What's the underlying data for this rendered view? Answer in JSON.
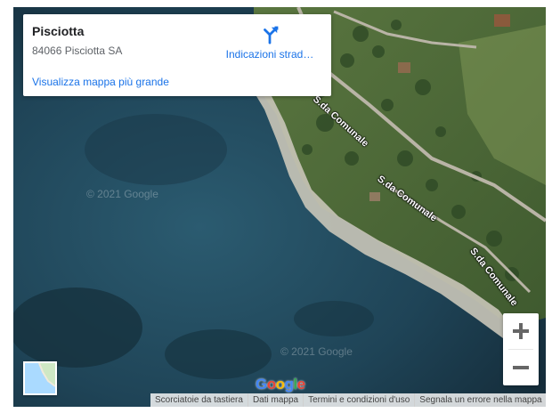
{
  "place": {
    "title": "Pisciotta",
    "address": "84066 Pisciotta SA",
    "larger_map_link": "Visualizza mappa più grande",
    "directions_label": "Indicazioni strad…"
  },
  "map": {
    "road_label_upper": "S.da Comunale",
    "road_label_middle": "S.da Comunale",
    "road_label_lower": "S.da Comunale",
    "copyright_top": "© 2021 Google",
    "copyright_bottom": "© 2021 Google",
    "layer_toggle_icon": "map-thumbnail-icon"
  },
  "zoom": {
    "zoom_in_icon": "plus-icon",
    "zoom_out_icon": "minus-icon"
  },
  "footer": {
    "keyboard_shortcuts": "Scorciatoie da tastiera",
    "map_data": "Dati mappa",
    "terms": "Termini e condizioni d'uso",
    "report_error": "Segnala un errore nella mappa"
  },
  "branding": {
    "google_letters": [
      "G",
      "o",
      "o",
      "g",
      "l",
      "e"
    ],
    "google_colors": [
      "#4285F4",
      "#EA4335",
      "#FBBC05",
      "#4285F4",
      "#34A853",
      "#EA4335"
    ]
  },
  "colors": {
    "link": "#1a73e8",
    "sea_deep": "#1c3a4b",
    "land_green": "#5f7a3e",
    "beach": "#c9c5b8"
  }
}
